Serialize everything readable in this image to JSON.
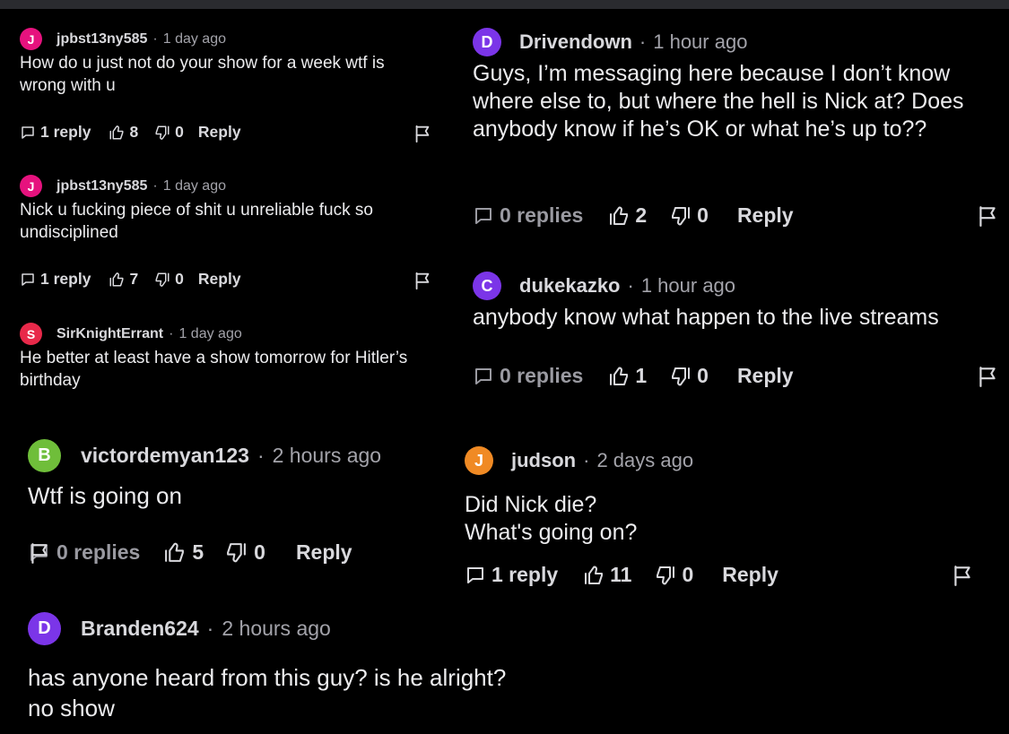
{
  "comments": [
    {
      "avatar_letter": "J",
      "avatar_color": "#e6127e",
      "username": "jpbst13ny585",
      "separator": "·",
      "time": "1 day ago",
      "body": "How do u just not do your show for a week wtf is wrong with u",
      "replies": "1 reply",
      "likes": "8",
      "dislikes": "0",
      "reply_label": "Reply"
    },
    {
      "avatar_letter": "J",
      "avatar_color": "#e6127e",
      "username": "jpbst13ny585",
      "separator": "·",
      "time": "1 day ago",
      "body": "Nick u fucking piece of shit u unreliable fuck so undisciplined",
      "replies": "1 reply",
      "likes": "7",
      "dislikes": "0",
      "reply_label": "Reply"
    },
    {
      "avatar_letter": "S",
      "avatar_color": "#e8294a",
      "username": "SirKnightErrant",
      "separator": "·",
      "time": "1 day ago",
      "body": "He better at least have a show tomorrow for Hitler’s birthday"
    },
    {
      "avatar_letter": "D",
      "avatar_color": "#7b35e8",
      "username": "Drivendown",
      "separator": "·",
      "time": "1 hour ago",
      "body": "Guys, I’m messaging here because I don’t know where else to, but where the hell is Nick at? Does anybody know if he’s OK or what he’s up to??",
      "replies": "0 replies",
      "likes": "2",
      "dislikes": "0",
      "reply_label": "Reply"
    },
    {
      "avatar_letter": "C",
      "avatar_color": "#7b35e8",
      "username": "dukekazko",
      "separator": "·",
      "time": "1 hour ago",
      "body": "anybody know what happen to the live streams",
      "replies": "0 replies",
      "likes": "1",
      "dislikes": "0",
      "reply_label": "Reply"
    },
    {
      "avatar_letter": "B",
      "avatar_color": "#6fbe3a",
      "username": "victordemyan123",
      "separator": "·",
      "time": "2 hours ago",
      "body": "Wtf is going on",
      "replies": "0 replies",
      "likes": "5",
      "dislikes": "0",
      "reply_label": "Reply"
    },
    {
      "avatar_letter": "J",
      "avatar_color": "#f08a24",
      "username": "judson",
      "separator": "·",
      "time": "2 days ago",
      "body": "Did Nick die?\nWhat's going on?",
      "replies": "1 reply",
      "likes": "11",
      "dislikes": "0",
      "reply_label": "Reply"
    },
    {
      "avatar_letter": "D",
      "avatar_color": "#7b35e8",
      "username": "Branden624",
      "separator": "·",
      "time": "2 hours ago",
      "body": "has anyone heard from this guy? is he alright?\nno show"
    }
  ]
}
